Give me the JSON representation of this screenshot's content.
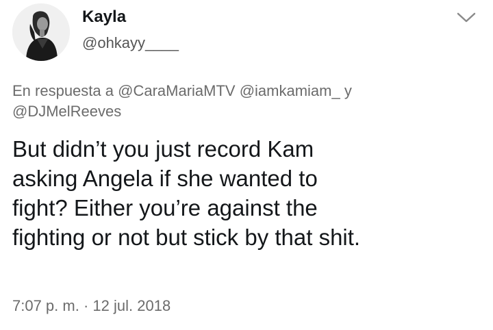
{
  "user": {
    "display_name": "Kayla",
    "handle": "@ohkayy____",
    "avatar_icon": "profile-photo"
  },
  "reply": {
    "prefix": "En respuesta a",
    "mentions": [
      "@CaraMariaMTV",
      "@iamkamiam_",
      "@DJMelReeves"
    ],
    "joiner": "y"
  },
  "tweet": {
    "text_lines": [
      "But didn’t you just record Kam",
      "asking Angela if she wanted to",
      "fight? Either you’re against the",
      "fighting or not but stick by that shit."
    ],
    "time": "7:07 p. m.",
    "separator": "·",
    "date": "12 jul. 2018"
  },
  "menu": {
    "icon": "chevron-down-icon"
  }
}
